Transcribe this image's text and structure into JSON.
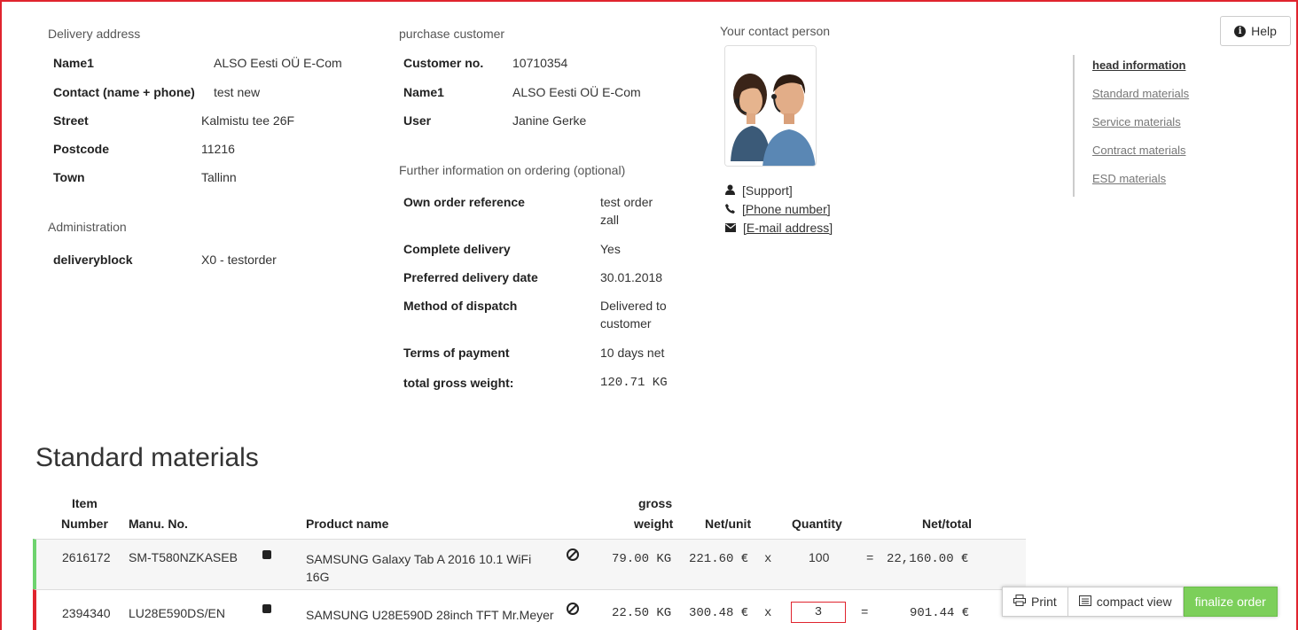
{
  "delivery": {
    "title": "Delivery address",
    "rows": [
      {
        "label": "Name1",
        "value": "ALSO Eesti OÜ E-Com"
      },
      {
        "label": "Contact (name + phone)",
        "value": "test new"
      },
      {
        "label": "Street",
        "value": "Kalmistu tee 26F"
      },
      {
        "label": "Postcode",
        "value": "11216"
      },
      {
        "label": "Town",
        "value": "Tallinn"
      }
    ]
  },
  "administration": {
    "title": "Administration",
    "label": "deliveryblock",
    "value": "X0 - testorder"
  },
  "purchase": {
    "title": "purchase customer",
    "rows": [
      {
        "label": "Customer no.",
        "value": "10710354"
      },
      {
        "label": "Name1",
        "value": "ALSO Eesti OÜ E-Com"
      },
      {
        "label": "User",
        "value": "Janine Gerke"
      }
    ]
  },
  "further": {
    "title": "Further information on ordering (optional)",
    "rows": [
      {
        "label": "Own order reference",
        "value": "test order zall"
      },
      {
        "label": "Complete delivery",
        "value": "Yes"
      },
      {
        "label": "Preferred delivery date",
        "value": "30.01.2018"
      },
      {
        "label": "Method of dispatch",
        "value": "Delivered to customer"
      },
      {
        "label": "Terms of payment",
        "value": "10 days net"
      },
      {
        "label": "total gross weight:",
        "value": "120.71 KG"
      }
    ]
  },
  "contact": {
    "title": "Your contact person",
    "support": "[Support]",
    "phone": "[Phone number]",
    "email": "[E-mail address]"
  },
  "help_label": "Help",
  "nav": {
    "items": [
      "head information",
      "Standard materials",
      "Service materials",
      "Contract materials",
      "ESD materials"
    ]
  },
  "materials": {
    "title": "Standard materials",
    "headers": {
      "item_line1": "Item",
      "item_line2": "Number",
      "manu": "Manu. No.",
      "product": "Product name",
      "gross_line1": "gross",
      "gross_line2": "weight",
      "net_unit": "Net/unit",
      "quantity": "Quantity",
      "net_total": "Net/total"
    },
    "rows": [
      {
        "item": "2616172",
        "manu": "SM-T580NZKASEB",
        "product": "SAMSUNG Galaxy Tab A 2016 10.1 WiFi 16G",
        "weight": "79.00 KG",
        "net_unit": "221.60 €",
        "x": "x",
        "qty": "100",
        "eq": "=",
        "net_total": "22,160.00 €"
      },
      {
        "item": "2394340",
        "manu": "LU28E590DS/EN",
        "product": "SAMSUNG U28E590D 28inch TFT Mr.Meyer",
        "weight": "22.50 KG",
        "net_unit": "300.48 €",
        "x": "x",
        "qty": "3",
        "eq": "=",
        "net_total": "901.44 €"
      }
    ]
  },
  "toolbar": {
    "print": "Print",
    "compact": "compact view",
    "finalize": "finalize order"
  },
  "colors": {
    "accent_red": "#e0242e",
    "ok_green": "#6ed36e",
    "finalize_green": "#7ccf5a"
  }
}
